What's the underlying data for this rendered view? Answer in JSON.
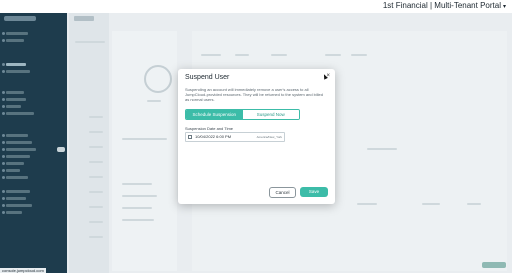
{
  "portal": {
    "org_name": "1st Financial | Multi-Tenant Portal",
    "caret": "▾"
  },
  "browser": {
    "status_url": "console.jumpcloud.com"
  },
  "modal": {
    "title": "Suspend User",
    "close_glyph": "×",
    "description": "Suspending an account will immediately remove a user's access to all JumpCloud-provided resources. They will be returned to the system and billed as normal users.",
    "options": [
      {
        "label": "Schedule Suspension",
        "selected": true
      },
      {
        "label": "Suspend Now",
        "selected": false
      }
    ],
    "date_label": "Suspension Date and Time",
    "date_value": "10/04/2022 6:00 PM",
    "timezone": "America/New_York",
    "cancel_label": "Cancel",
    "save_label": "Save"
  },
  "colors": {
    "accent": "#3cbca8",
    "sidebar": "#1e3c4d",
    "overlay": "#e9edf0"
  }
}
